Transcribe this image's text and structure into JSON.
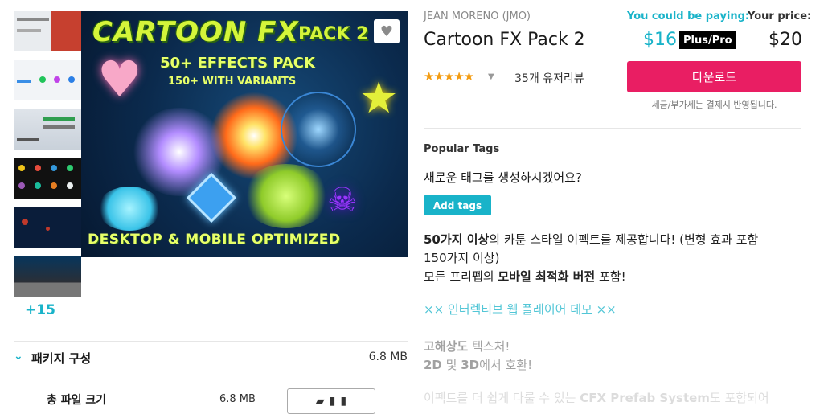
{
  "gallery": {
    "more_count": "+15",
    "hero": {
      "title": "CARTOON FX",
      "pack_label": "PACK 2",
      "subtitle": "50+ EFFECTS PACK",
      "subtitle2": "150+ WITH VARIANTS",
      "bottom": "DESKTOP & MOBILE OPTIMIZED"
    }
  },
  "product": {
    "publisher": "JEAN MORENO (JMO)",
    "title": "Cartoon FX Pack 2",
    "rating_stars": "★★★★★",
    "reviews": "35개 유저리뷰"
  },
  "pricing": {
    "could_label": "You could be paying:",
    "could_price": "$16",
    "plus_badge": "Plus/Pro",
    "your_label": "Your price:",
    "your_price": "$20",
    "download": "다운로드",
    "tax_note": "세금/부가세는 결제시 반영됩니다."
  },
  "tags": {
    "title": "Popular Tags",
    "question": "새로운 태그를 생성하시겠어요?",
    "add_button": "Add tags"
  },
  "description": {
    "line1_bold": "50가지 이상",
    "line1_rest": "의 카툰 스타일 이펙트를 제공합니다! (변형 효과 포함",
    "line2": "150가지 이상)",
    "line3_pre": "모든 프리펩의 ",
    "line3_bold": "모바일 최적화 버전",
    "line3_post": " 포함!",
    "demo_link": "×× 인터렉티브 웹 플레이어 데모 ××",
    "line4_bold": "고해상도",
    "line4_rest": " 텍스처!",
    "line5_bold1": "2D",
    "line5_mid": " 및 ",
    "line5_bold2": "3D",
    "line5_rest": "에서 호환!",
    "line6_pre": "이펙트를 더 쉽게 다룰 수 있는 ",
    "line6_bold": "CFX Prefab System",
    "line6_post": "도 포함되어"
  },
  "package": {
    "title": "패키지 구성",
    "size": "6.8 MB",
    "row_label": "총 파일 크기",
    "row_value": "6.8 MB"
  }
}
